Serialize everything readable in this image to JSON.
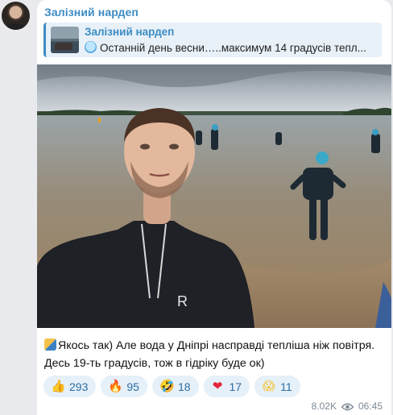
{
  "channel": {
    "name": "Залізний нардеп"
  },
  "reply": {
    "sender": "Залізний нардеп",
    "text": "Останній день весни…..максимум 14 градусів тепл..."
  },
  "message": {
    "line1": "Якось так) Але вода у Дніпрі насправді тепліша ніж повітря.",
    "line2": "Десь 19-ть градусів, тож в гідріку буде ок)",
    "views": "8.02K",
    "time": "06:45"
  },
  "reactions": [
    {
      "icon": "thumbs-up-icon",
      "glyph": "👍",
      "count": "293",
      "color": "#f5b324"
    },
    {
      "icon": "fire-icon",
      "glyph": "🔥",
      "count": "95",
      "color": "#f06a24"
    },
    {
      "icon": "grinning-face-icon",
      "glyph": "🤣",
      "count": "18",
      "color": "#f5c53a"
    },
    {
      "icon": "heart-icon",
      "glyph": "❤",
      "count": "17",
      "color": "#e5243b"
    },
    {
      "icon": "screaming-face-icon",
      "glyph": "😱",
      "count": "11",
      "color": "#f5c53a"
    }
  ],
  "colors": {
    "accent": "#3d8cc4",
    "bubble": "#ffffff",
    "background": "#e9eaed",
    "reaction_bg": "#e6f0f8"
  }
}
